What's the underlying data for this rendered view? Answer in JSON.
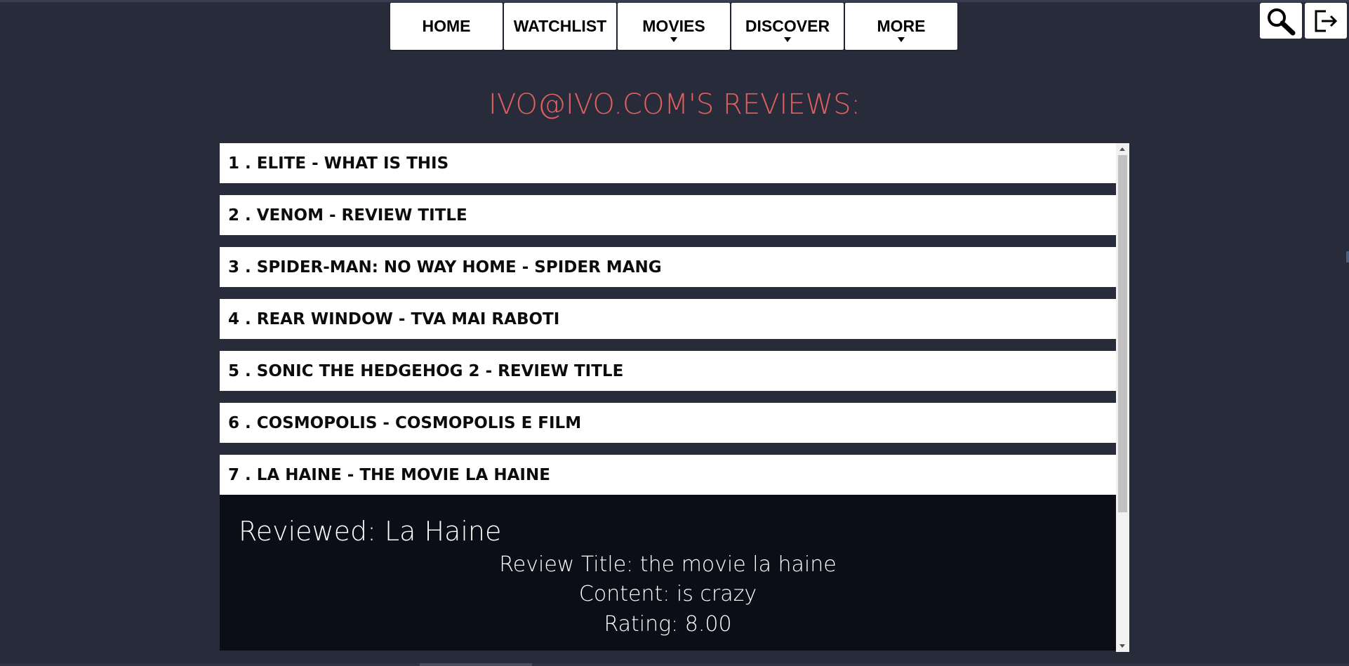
{
  "nav": {
    "items": [
      {
        "label": "HOME",
        "dropdown": false
      },
      {
        "label": "WATCHLIST",
        "dropdown": false
      },
      {
        "label": "MOVIES",
        "dropdown": true
      },
      {
        "label": "DISCOVER",
        "dropdown": true
      },
      {
        "label": "MORE",
        "dropdown": true
      }
    ]
  },
  "toolbar": {
    "search_icon": "magnifier-icon",
    "logout_icon": "logout-icon"
  },
  "heading": "IVO@IVO.COM'S REVIEWS:",
  "reviews": [
    "1 . ELITE - WHAT IS THIS",
    "2 . VENOM - REVIEW TITLE",
    "3 . SPIDER-MAN: NO WAY HOME - SPIDER MANG",
    "4 . REAR WINDOW - TVA MAI RABOTI",
    "5 . SONIC THE HEDGEHOG 2 - REVIEW TITLE",
    "6 . COSMOPOLIS - COSMOPOLIS E FILM",
    "7 . LA HAINE - THE MOVIE LA HAINE"
  ],
  "detail": {
    "title": "Reviewed: La Haine",
    "review_title": "Review Title: the movie la haine",
    "content": "Content: is crazy",
    "rating": "Rating: 8.00"
  },
  "colors": {
    "background": "#272b3a",
    "heading": "#e06060",
    "detail_bg": "#0b0e16"
  }
}
